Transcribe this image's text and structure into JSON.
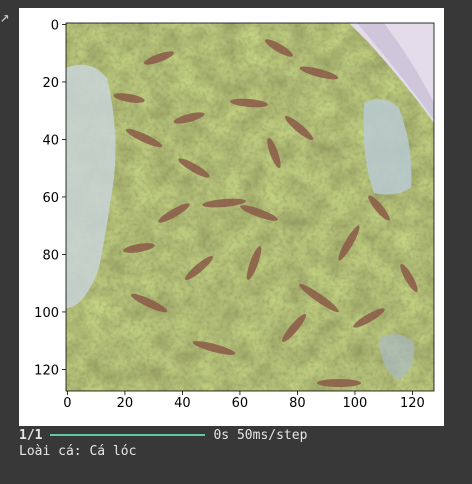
{
  "cell_icon": "output-arrow-icon",
  "figure": {
    "image_subject": "fish-in-tank-photo",
    "x_ticks": [
      "0",
      "20",
      "40",
      "60",
      "80",
      "100",
      "120"
    ],
    "y_ticks": [
      "0",
      "20",
      "40",
      "60",
      "80",
      "100",
      "120"
    ],
    "x_range": [
      0,
      128
    ],
    "y_range": [
      0,
      128
    ]
  },
  "progress": {
    "count": "1/1",
    "fraction": 1.0,
    "bar_color": "#5ec8a8",
    "timing": "0s 50ms/step"
  },
  "result": {
    "text": "Loài cá: Cá lóc"
  }
}
